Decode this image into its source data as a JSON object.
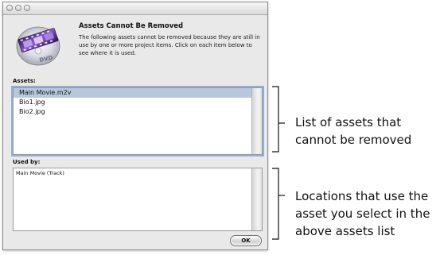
{
  "dialog": {
    "heading": "Assets Cannot Be Removed",
    "message": "The following assets cannot be removed because they are still in use by one or more project items. Click on each item below to see where it is used.",
    "assets_label": "Assets:",
    "assets": [
      "Main Movie.m2v",
      "Bio1.jpg",
      "Bio2.jpg"
    ],
    "selected_asset_index": 0,
    "used_by_label": "Used by:",
    "used_by": [
      "Main Movie (Track)"
    ],
    "ok_label": "OK",
    "icon": "dvd-icon"
  },
  "callouts": {
    "assets_list": [
      "List of assets that",
      "cannot be removed"
    ],
    "used_by_list": [
      "Locations that use the",
      "asset you select in the",
      "above assets list"
    ]
  },
  "colors": {
    "selection": "#b8c7dc",
    "focus_ring": "#8fb0dc",
    "window_bg": "#e9e9e9"
  }
}
